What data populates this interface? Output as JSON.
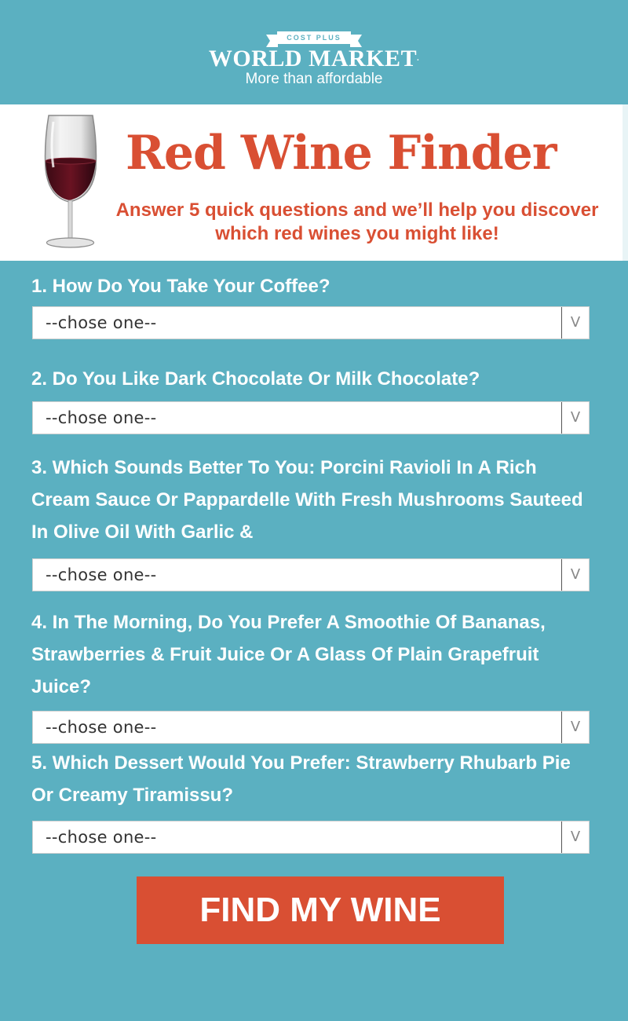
{
  "brand": {
    "banner": "COST PLUS",
    "name": "WORLD MARKET",
    "trademark": ".",
    "tagline": "More than affordable"
  },
  "hero": {
    "title": "Red Wine Finder",
    "subtitle": "Answer 5 quick questions and we’ll help you discover which red wines you might like!",
    "image": "red-wine-glass"
  },
  "questions": [
    {
      "label": "1. How Do You Take Your Coffee?",
      "selected": "--chose one--"
    },
    {
      "label": "2. Do You Like Dark Chocolate Or Milk Chocolate?",
      "selected": "--chose one--"
    },
    {
      "label": "3. Which Sounds Better To You: Porcini Ravioli In A Rich Cream Sauce Or Pappardelle With Fresh Mushrooms Sauteed In Olive Oil With Garlic &",
      "selected": "--chose one--"
    },
    {
      "label": "4. In The Morning, Do You Prefer A Smoothie Of Bananas, Strawberries & Fruit Juice Or A Glass Of Plain Grapefruit Juice?",
      "selected": "--chose one--"
    },
    {
      "label": "5. Which Dessert Would You Prefer: Strawberry Rhubarb Pie Or Creamy Tiramissu?",
      "selected": "--chose one--"
    }
  ],
  "select_arrow": "V",
  "submit_label": "FIND MY WINE",
  "colors": {
    "background": "#5bb0c1",
    "accent": "#d94f33",
    "panel": "#ffffff"
  }
}
